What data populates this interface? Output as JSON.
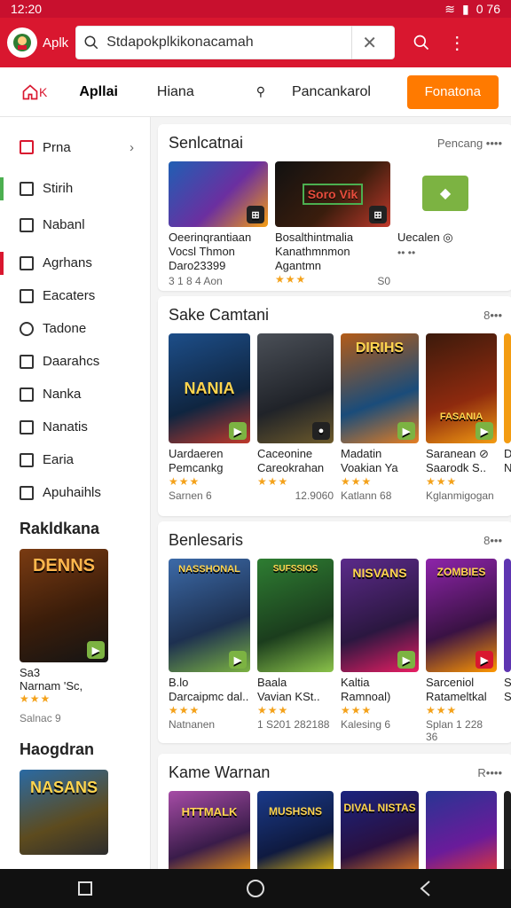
{
  "status": {
    "time": "12:20",
    "right_text": "0 76"
  },
  "appbar": {
    "logo_text": "Aplk",
    "search_value": "Stdapokplkikonacamah"
  },
  "tabs": {
    "items": [
      {
        "label": "K"
      },
      {
        "label": "Apllai"
      },
      {
        "label": "Hiana"
      },
      {
        "label": "Pancankarol"
      }
    ],
    "cta": "Fonatona"
  },
  "sidebar": {
    "items": [
      {
        "label": "Prna"
      },
      {
        "label": "Stirih"
      },
      {
        "label": "Nabanl"
      },
      {
        "label": "Agrhans"
      },
      {
        "label": "Eacaters"
      },
      {
        "label": "Tadone"
      },
      {
        "label": "Daarahcs"
      },
      {
        "label": "Nanka"
      },
      {
        "label": "Nanatis"
      },
      {
        "label": "Earia"
      },
      {
        "label": "Apuhaihls"
      }
    ],
    "section1": {
      "title": "Rakldkana",
      "card": {
        "art": "DENNS",
        "line1": "Sa3",
        "line2": "Narnam 'Sc,",
        "stars": "★★★",
        "meta": "Salnac 9"
      }
    },
    "section2": {
      "title": "Haogdran",
      "card": {
        "art": "NASANS"
      }
    }
  },
  "panels": {
    "p1": {
      "title": "Senlcatnai",
      "more": "Pencang ••••",
      "cards": [
        {
          "art": "",
          "l1": "Oeerinqrantiaan",
          "l2": "Vocsl Thmon",
          "l3": "Daro23399",
          "l4": "3 1 8 4 Aon"
        },
        {
          "art": "Soro Vik",
          "l1": "Bosalthintmalia",
          "l2": "Kanathmnmon",
          "l3": "Agantmn",
          "l4": "★★★",
          "l5": "S0"
        },
        {
          "art": "",
          "l1": "Uecalen ◎"
        }
      ]
    },
    "p2": {
      "title": "Sake Camtani",
      "more": "8•••",
      "cards": [
        {
          "art": "NANIA",
          "t1": "Uardaeren",
          "t2": "Pemcankg",
          "stars": "★★★",
          "meta": "Sarnen 6"
        },
        {
          "art": "",
          "t1": "Caceonine",
          "t2": "Careokrahan",
          "stars": "★★★",
          "meta": "12.9060"
        },
        {
          "art": "DIRIHS",
          "t1": "Madatin",
          "t2": "Voakian Ya",
          "stars": "★★★",
          "meta": "Katlann 68"
        },
        {
          "art": "FASANIA",
          "t1": "Saranean ⊘",
          "t2": "Saarodk S..",
          "stars": "★★★",
          "meta": "Kglanmigogan"
        },
        {
          "art": "",
          "t1": "D",
          "t2": "N",
          "stars": "",
          "meta": ""
        }
      ]
    },
    "p3": {
      "title": "Benlesaris",
      "more": "8•••",
      "cards": [
        {
          "art": "NASSHONAL",
          "t1": "B.lo",
          "t2": "Darcaipmc dal..",
          "stars": "★★★",
          "meta": "Natnanen"
        },
        {
          "art": "SUFSSIOS",
          "t1": "Baala",
          "t2": "Vavian KSt..",
          "stars": "★★★",
          "meta": "1 S201 282188"
        },
        {
          "art": "NISVANS",
          "t1": "Kaltia",
          "t2": "Ramnoal)",
          "stars": "★★★",
          "meta": "Kalesing 6"
        },
        {
          "art": "ZOMBIES",
          "t1": "Sarceniol",
          "t2": "Ratameltkal",
          "stars": "★★★",
          "meta": "Splan 1 228 36"
        },
        {
          "art": "",
          "t1": "S",
          "t2": "S",
          "stars": "",
          "meta": ""
        }
      ]
    },
    "p4": {
      "title": "Kame Warnan",
      "more": "R••••",
      "cards": [
        {
          "art": "HTTMALK"
        },
        {
          "art": "MUSHSNS"
        },
        {
          "art": "DIVAL NISTAS"
        },
        {
          "art": ""
        },
        {
          "art": ""
        }
      ]
    }
  },
  "colors": {
    "primary": "#d9172f",
    "accent": "#ff7a00",
    "star": "#f4a21b"
  },
  "icons": {
    "search": "search-icon",
    "clear": "close-icon",
    "more": "more-vertical-icon"
  }
}
